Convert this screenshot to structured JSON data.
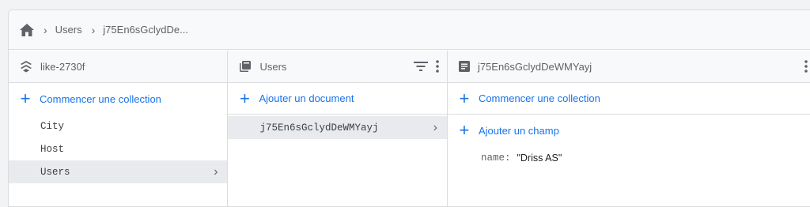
{
  "breadcrumb": {
    "home_icon": "home-icon",
    "items": [
      "Users",
      "j75En6sGclydDe..."
    ]
  },
  "columns": {
    "root": {
      "title": "like-2730f",
      "icon": "firestore-layers-icon",
      "action_label": "Commencer une collection",
      "items": [
        "City",
        "Host",
        "Users"
      ],
      "selected": "Users"
    },
    "collection": {
      "title": "Users",
      "icon": "collection-icon",
      "action_label": "Ajouter un document",
      "items": [
        "j75En6sGclydDeWMYayj"
      ],
      "selected": "j75En6sGclydDeWMYayj"
    },
    "document": {
      "title": "j75En6sGclydDeWMYayj",
      "icon": "document-icon",
      "action_collection_label": "Commencer une collection",
      "action_field_label": "Ajouter un champ",
      "fields": [
        {
          "key": "name",
          "value": "\"Driss AS\""
        }
      ]
    }
  },
  "colors": {
    "accent": "#1a73e8",
    "selected_bg": "#e8eaed",
    "header_bg": "#f8f9fa"
  }
}
